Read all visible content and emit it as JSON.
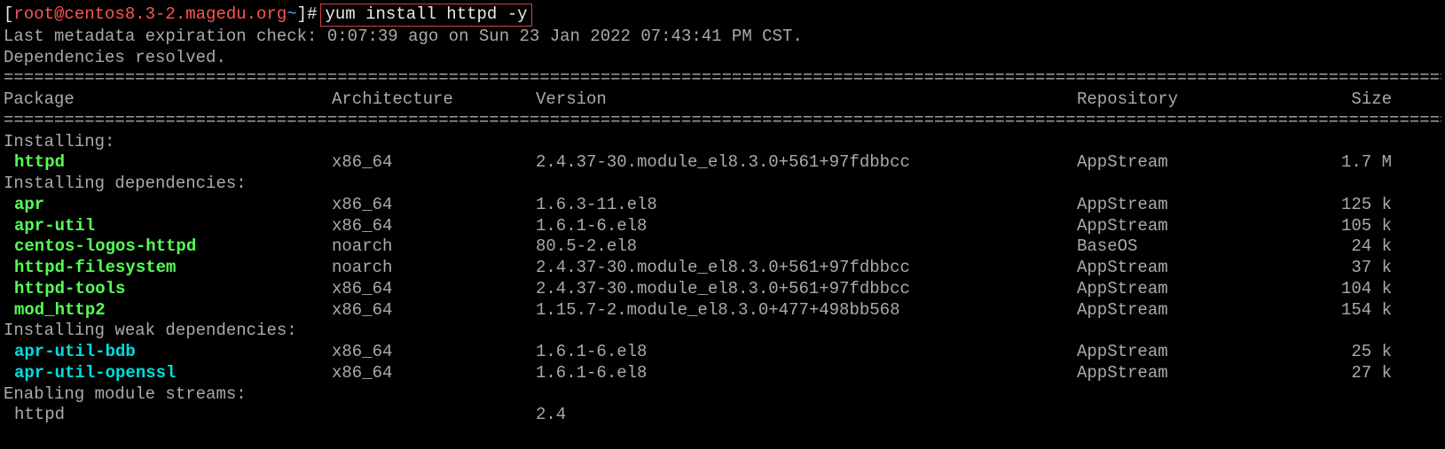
{
  "prompt": {
    "open_bracket": "[",
    "user_host": "root@centos8.3-2.magedu.org",
    "tilde": " ~",
    "close_bracket": "]",
    "hash": "#",
    "command": "yum install httpd -y"
  },
  "output": {
    "metadata_line": "Last metadata expiration check: 0:07:39 ago on Sun 23 Jan 2022 07:43:41 PM CST.",
    "deps_resolved": "Dependencies resolved."
  },
  "divider": "====================================================================================================================================================",
  "headers": {
    "package": "Package",
    "architecture": "Architecture",
    "version": "Version",
    "repository": "Repository",
    "size": "Size"
  },
  "sections": {
    "installing": "Installing:",
    "installing_deps": "Installing dependencies:",
    "installing_weak": "Installing weak dependencies:",
    "enabling_modules": "Enabling module streams:"
  },
  "packages": {
    "main": [
      {
        "name": "httpd",
        "arch": "x86_64",
        "version": "2.4.37-30.module_el8.3.0+561+97fdbbcc",
        "repo": "AppStream",
        "size": "1.7 M"
      }
    ],
    "deps": [
      {
        "name": "apr",
        "arch": "x86_64",
        "version": "1.6.3-11.el8",
        "repo": "AppStream",
        "size": "125 k"
      },
      {
        "name": "apr-util",
        "arch": "x86_64",
        "version": "1.6.1-6.el8",
        "repo": "AppStream",
        "size": "105 k"
      },
      {
        "name": "centos-logos-httpd",
        "arch": "noarch",
        "version": "80.5-2.el8",
        "repo": "BaseOS",
        "size": "24 k"
      },
      {
        "name": "httpd-filesystem",
        "arch": "noarch",
        "version": "2.4.37-30.module_el8.3.0+561+97fdbbcc",
        "repo": "AppStream",
        "size": "37 k"
      },
      {
        "name": "httpd-tools",
        "arch": "x86_64",
        "version": "2.4.37-30.module_el8.3.0+561+97fdbbcc",
        "repo": "AppStream",
        "size": "104 k"
      },
      {
        "name": "mod_http2",
        "arch": "x86_64",
        "version": "1.15.7-2.module_el8.3.0+477+498bb568",
        "repo": "AppStream",
        "size": "154 k"
      }
    ],
    "weak": [
      {
        "name": "apr-util-bdb",
        "arch": "x86_64",
        "version": "1.6.1-6.el8",
        "repo": "AppStream",
        "size": "25 k"
      },
      {
        "name": "apr-util-openssl",
        "arch": "x86_64",
        "version": "1.6.1-6.el8",
        "repo": "AppStream",
        "size": "27 k"
      }
    ],
    "modules": [
      {
        "name": "httpd",
        "arch": "",
        "version": "2.4",
        "repo": "",
        "size": ""
      }
    ]
  }
}
